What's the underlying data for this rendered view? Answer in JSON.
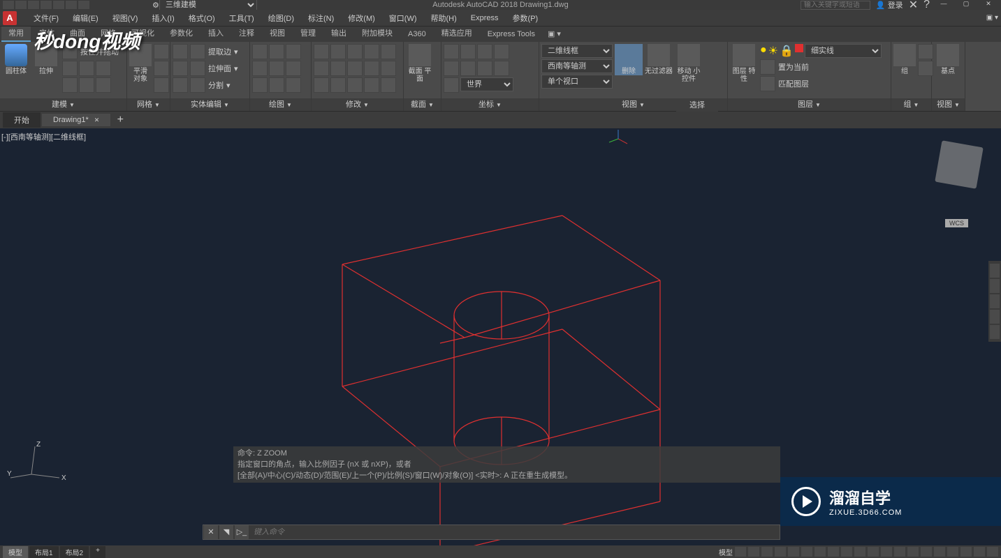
{
  "app": {
    "logo_letter": "A",
    "title": "Autodesk AutoCAD 2018   Drawing1.dwg",
    "workspace": "三维建模",
    "search_placeholder": "输入关键字或短语",
    "login": "登录"
  },
  "menubar": [
    "文件(F)",
    "编辑(E)",
    "视图(V)",
    "插入(I)",
    "格式(O)",
    "工具(T)",
    "绘图(D)",
    "标注(N)",
    "修改(M)",
    "窗口(W)",
    "帮助(H)",
    "Express",
    "参数(P)"
  ],
  "ribbon_tabs": [
    "常用",
    "实体",
    "曲面",
    "网格",
    "可视化",
    "参数化",
    "插入",
    "注释",
    "视图",
    "管理",
    "输出",
    "附加模块",
    "A360",
    "精选应用",
    "Express Tools"
  ],
  "active_ribbon_tab": 0,
  "panels": {
    "model": {
      "label": "建模",
      "big1": "圆柱体",
      "big2": "拉伸",
      "pushpull": "按住并拖动",
      "smooth": "平滑\n对象"
    },
    "mesh": {
      "label": "网格"
    },
    "solid_edit": {
      "label": "实体编辑",
      "extract": "提取边",
      "extrude_face": "拉伸面",
      "separate": "分割"
    },
    "draw": {
      "label": "绘图"
    },
    "modify": {
      "label": "修改"
    },
    "section": {
      "label": "截面",
      "big": "截面\n平面"
    },
    "coord": {
      "label": "坐标",
      "ucs_combo": "世界"
    },
    "view": {
      "label": "视图",
      "visual_style": "二维线框",
      "view_preset": "西南等轴测",
      "viewport": "单个视口",
      "erase": "删除",
      "nofilter": "无过滤器",
      "move_widget": "移动\n小控件"
    },
    "select": {
      "label": "选择"
    },
    "layer": {
      "label": "图层",
      "props": "图层\n特性",
      "lineweight": "细实线",
      "set_current": "置为当前",
      "match": "匹配图层"
    },
    "group": {
      "label": "组",
      "big": "组"
    },
    "view2": {
      "label": "视图",
      "big": "基点"
    }
  },
  "doc_tabs": {
    "start": "开始",
    "drawing": "Drawing1*"
  },
  "viewport_label": "[-][西南等轴测][二维线框]",
  "wcs": "WCS",
  "ucs": {
    "x": "X",
    "y": "Y",
    "z": "Z"
  },
  "watermark_video": "秒dong视频",
  "watermark_brand": {
    "text": "溜溜自学",
    "url": "ZIXUE.3D66.COM"
  },
  "cmd_history": [
    "命令: Z ZOOM",
    "指定窗口的角点，输入比例因子 (nX 或 nXP)，或者",
    "[全部(A)/中心(C)/动态(D)/范围(E)/上一个(P)/比例(S)/窗口(W)/对象(O)] <实时>: A 正在重生成模型。"
  ],
  "cmd_placeholder": "键入命令",
  "status_tabs": [
    "模型",
    "布局1",
    "布局2"
  ],
  "status_right_model": "模型"
}
